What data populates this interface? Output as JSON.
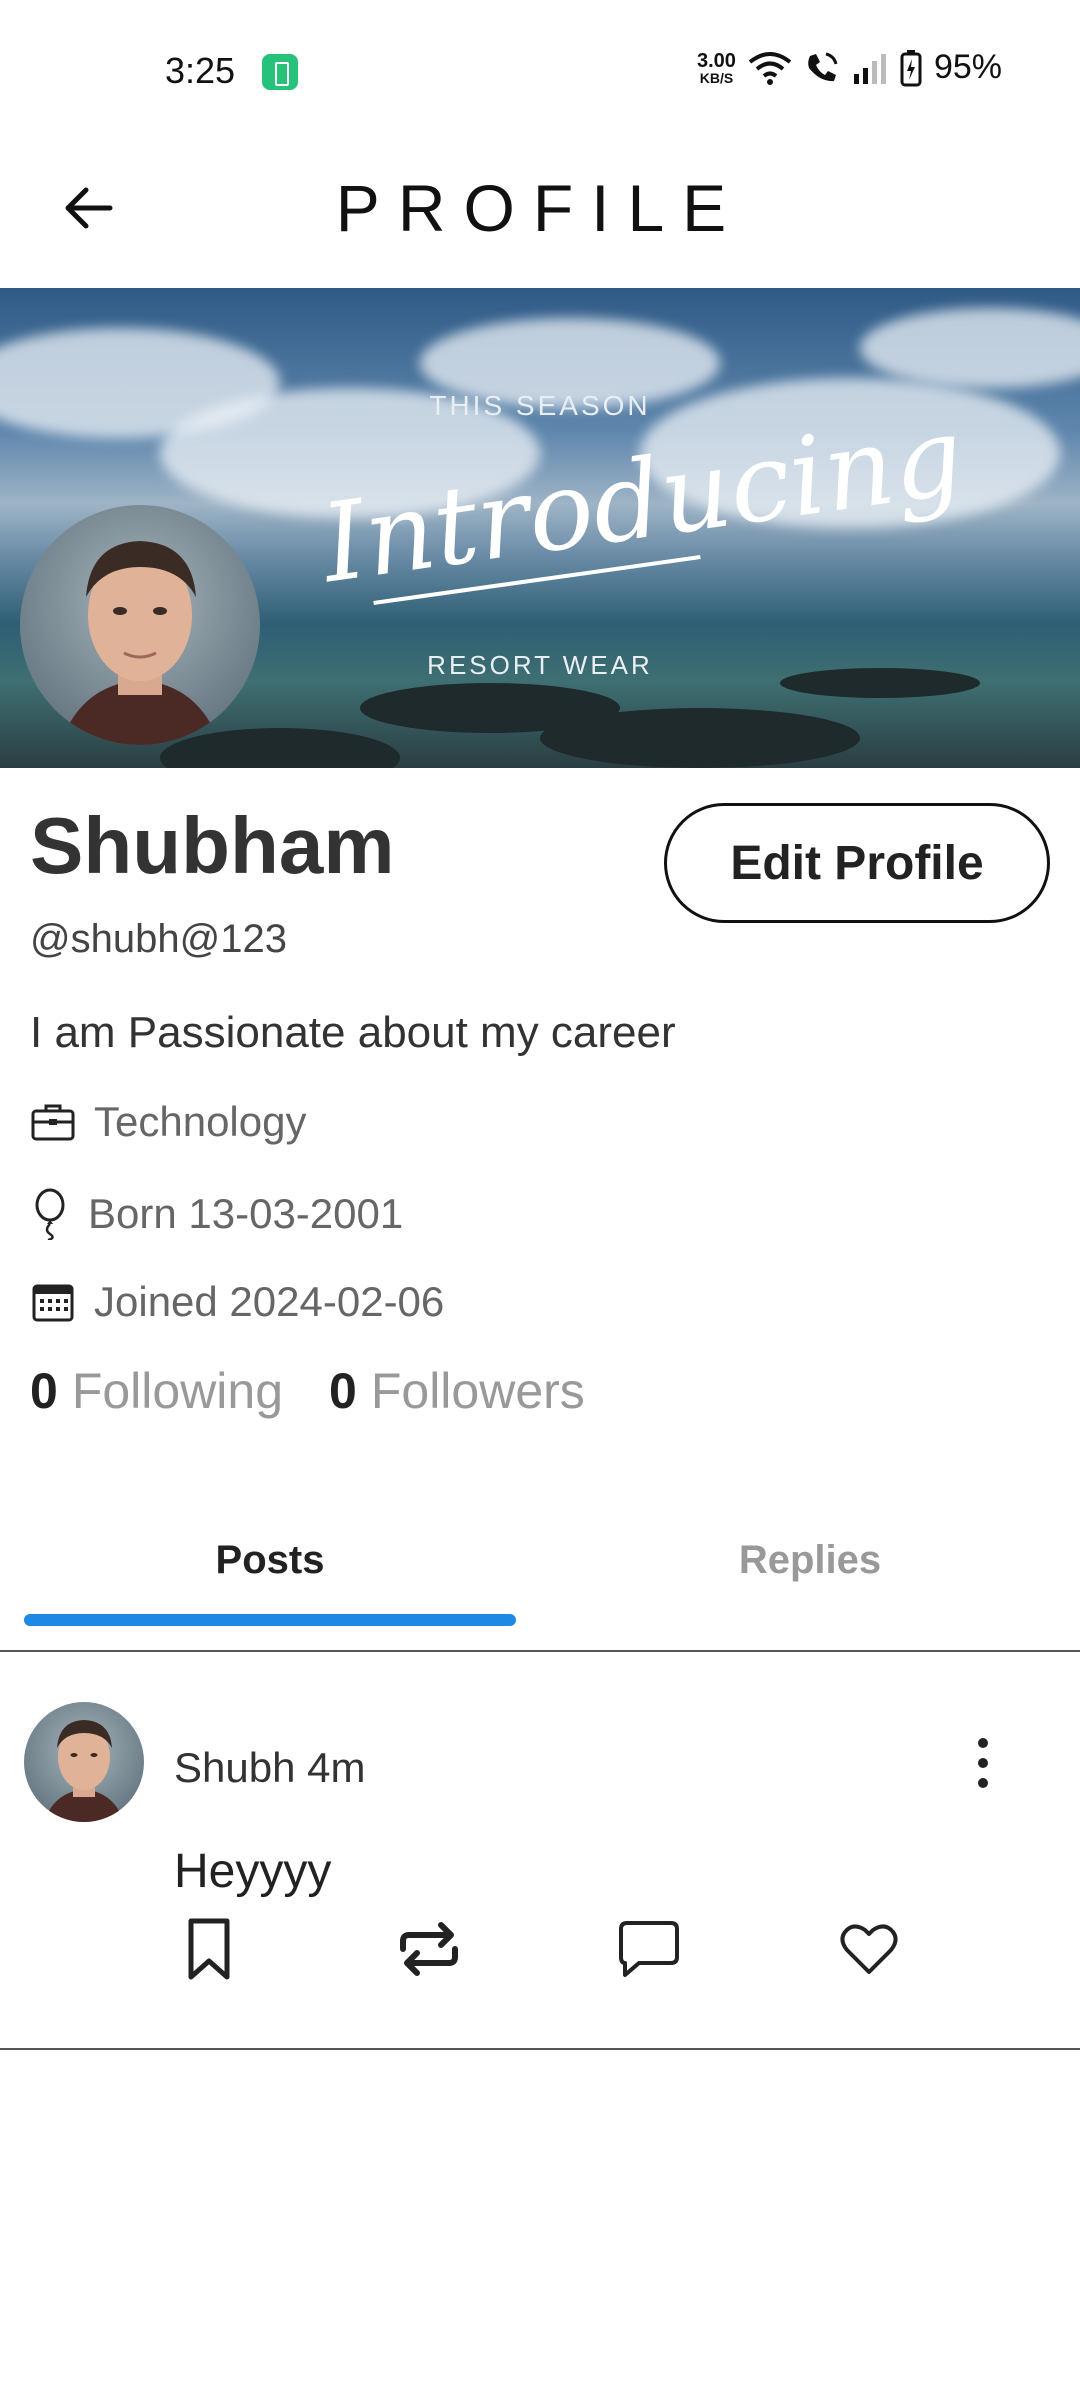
{
  "status_bar": {
    "time": "3:25",
    "net_speed_value": "3.00",
    "net_speed_unit": "KB/S",
    "battery": "95%"
  },
  "header": {
    "title": "PROFILE",
    "back_icon": "arrow-left-icon"
  },
  "banner": {
    "overline": "THIS SEASON",
    "script": "Introducing",
    "subline": "RESORT WEAR"
  },
  "profile": {
    "name": "Shubham",
    "handle": "@shubh@123",
    "bio": "I am Passionate about my career",
    "occupation": "Technology",
    "born": "Born 13-03-2001",
    "joined": "Joined 2024-02-06",
    "edit_button": "Edit Profile",
    "following_count": "0",
    "following_label": "Following",
    "followers_count": "0",
    "followers_label": "Followers"
  },
  "tabs": [
    {
      "label": "Posts",
      "active": true
    },
    {
      "label": "Replies",
      "active": false
    }
  ],
  "colors": {
    "accent": "#1e88e5",
    "status_icon": "#27c27a"
  },
  "posts": [
    {
      "author_time": "Shubh 4m",
      "text": "Heyyyy",
      "actions": [
        "bookmark-icon",
        "repost-icon",
        "comment-icon",
        "heart-icon"
      ]
    }
  ]
}
